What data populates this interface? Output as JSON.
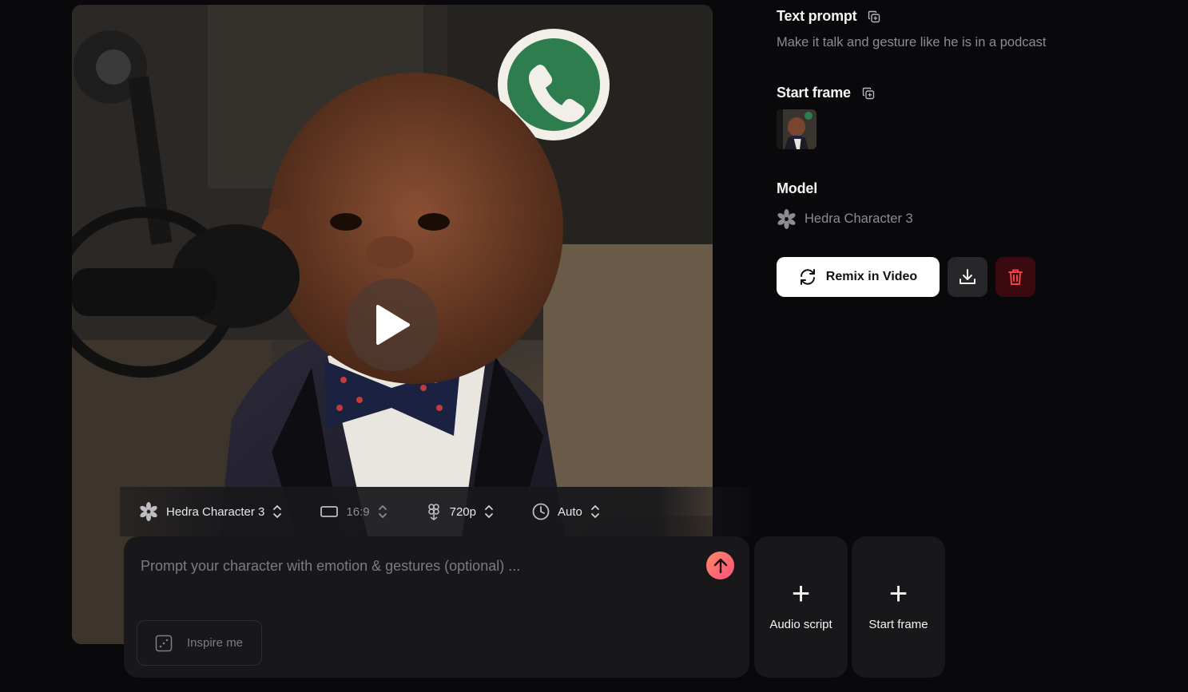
{
  "panel": {
    "text_prompt_heading": "Text prompt",
    "text_prompt_value": "Make it talk and gesture like he is in a podcast",
    "start_frame_heading": "Start frame",
    "model_heading": "Model",
    "model_value": "Hedra Character 3",
    "remix_label": "Remix in Video"
  },
  "settings": {
    "model": "Hedra Character 3",
    "aspect_ratio": "16:9",
    "resolution": "720p",
    "duration": "Auto"
  },
  "prompt": {
    "placeholder": "Prompt your character with emotion & gestures (optional) ...",
    "inspire_label": "Inspire me"
  },
  "cards": {
    "audio_script": "Audio script",
    "start_frame": "Start frame"
  },
  "icons": [
    "play-icon",
    "copy-icon",
    "hedra-logo-icon",
    "refresh-icon",
    "download-icon",
    "trash-icon",
    "aspect-ratio-icon",
    "resolution-icon",
    "clock-icon",
    "chevron-updown-icon",
    "arrow-up-icon",
    "dice-icon",
    "plus-icon"
  ],
  "colors": {
    "background": "#09090b",
    "card": "#18181b",
    "send_gradient_start": "#ff8a65",
    "send_gradient_end": "#ff4f7b",
    "delete_bg": "#3b0a10",
    "delete_icon": "#ef4444"
  }
}
